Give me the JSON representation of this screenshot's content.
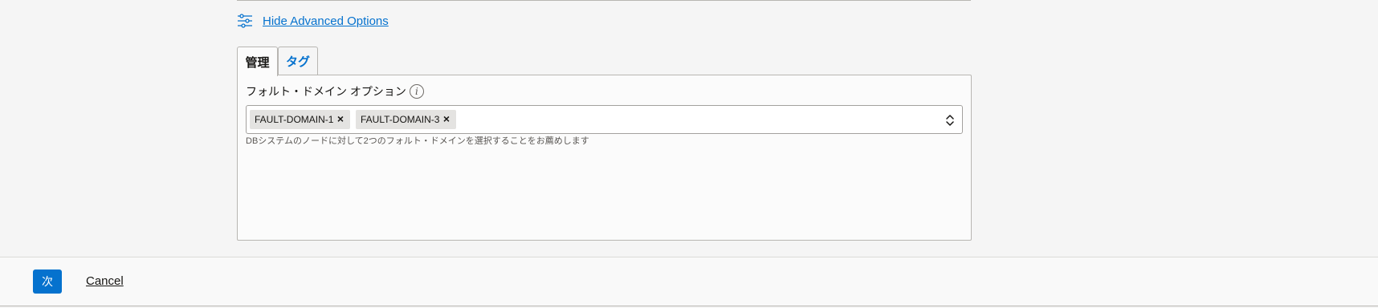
{
  "advanced_options": {
    "toggle_label": "Hide Advanced Options",
    "icon": "sliders-icon"
  },
  "tabs": [
    {
      "label": "管理",
      "active": true
    },
    {
      "label": "タグ",
      "active": false
    }
  ],
  "fault_domain": {
    "label": "フォルト・ドメイン オプション",
    "info_icon_glyph": "i",
    "selected": [
      "FAULT-DOMAIN-1",
      "FAULT-DOMAIN-3"
    ],
    "remove_glyph": "×",
    "help_text": "DBシステムのノードに対して2つのフォルト・ドメインを選択することをお薦めします"
  },
  "footer": {
    "next_label": "次",
    "cancel_label": "Cancel"
  },
  "colors": {
    "accent": "#0572ce",
    "chip_bg": "#e4e3e1",
    "page_bg": "#f5f5f5"
  }
}
